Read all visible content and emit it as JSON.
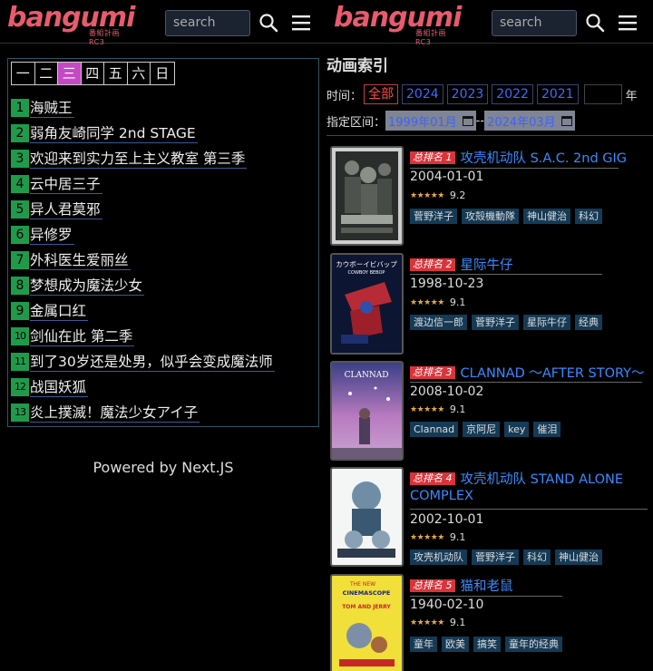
{
  "left": {
    "header": {
      "logo_text": "bangumi",
      "logo_sub": "番組計画RC3",
      "search_placeholder": "search"
    },
    "days": [
      "一",
      "二",
      "三",
      "四",
      "五",
      "六",
      "日"
    ],
    "active_day": "三",
    "anime_list": [
      {
        "num": "1",
        "title": "海贼王"
      },
      {
        "num": "2",
        "title": "弱角友崎同学 2nd STAGE"
      },
      {
        "num": "3",
        "title": "欢迎来到实力至上主义教室 第三季"
      },
      {
        "num": "4",
        "title": "云中居三子"
      },
      {
        "num": "5",
        "title": "异人君莫邪"
      },
      {
        "num": "6",
        "title": "异修罗"
      },
      {
        "num": "7",
        "title": "外科医生爱丽丝"
      },
      {
        "num": "8",
        "title": "梦想成为魔法少女"
      },
      {
        "num": "9",
        "title": "金属口红"
      },
      {
        "num": "10",
        "title": "剑仙在此 第二季"
      },
      {
        "num": "11",
        "title": "到了30岁还是处男，似乎会变成魔法师"
      },
      {
        "num": "12",
        "title": "战国妖狐"
      },
      {
        "num": "13",
        "title": "炎上撲滅！魔法少女アイ子"
      }
    ],
    "powered": "Powered by Next.JS"
  },
  "right": {
    "header": {
      "logo_text": "bangumi",
      "logo_sub": "番組計画RC3",
      "search_placeholder": "search"
    },
    "index_title": "动画索引",
    "time_label": "时间：",
    "years": [
      "全部",
      "2024",
      "2023",
      "2022",
      "2021"
    ],
    "active_year": "全部",
    "year_suffix": "年",
    "range_label": "指定区间：",
    "range_start": "1999年01月",
    "range_sep": "--",
    "range_end": "2024年03月",
    "cards": [
      {
        "rank": "总排名 1",
        "title": "攻壳机动队 S.A.C. 2nd GIG",
        "date": "2004-01-01",
        "stars": "★★★★★",
        "score": "9.2",
        "tags": [
          "菅野洋子",
          "攻殻機動隊",
          "神山健治",
          "科幻"
        ]
      },
      {
        "rank": "总排名 2",
        "title": "星际牛仔",
        "date": "1998-10-23",
        "stars": "★★★★★",
        "score": "9.1",
        "tags": [
          "渡边信一郎",
          "菅野洋子",
          "星际牛仔",
          "经典"
        ]
      },
      {
        "rank": "总排名 3",
        "title": "CLANNAD ～AFTER STORY～",
        "date": "2008-10-02",
        "stars": "★★★★★",
        "score": "9.1",
        "tags": [
          "Clannad",
          "京阿尼",
          "key",
          "催泪"
        ]
      },
      {
        "rank": "总排名 4",
        "title": "攻壳机动队 STAND ALONE",
        "title2": "COMPLEX",
        "date": "2002-10-01",
        "stars": "★★★★★",
        "score": "9.1",
        "tags": [
          "攻壳机动队",
          "菅野洋子",
          "科幻",
          "神山健治"
        ]
      },
      {
        "rank": "总排名 5",
        "title": "猫和老鼠",
        "date": "1940-02-10",
        "stars": "★★★★★",
        "score": "9.1",
        "tags": [
          "童年",
          "欧美",
          "搞笑",
          "童年的经典"
        ]
      }
    ],
    "poster_texts": {
      "p2_top": "カウボーイビバップ",
      "p2_sub": "COWBOY BEBOP",
      "p3_top": "CLANNAD",
      "p5_top": "THE NEW",
      "p5_brand": "CINEMASCOPE",
      "p5_name": "TOM AND JERRY"
    }
  }
}
